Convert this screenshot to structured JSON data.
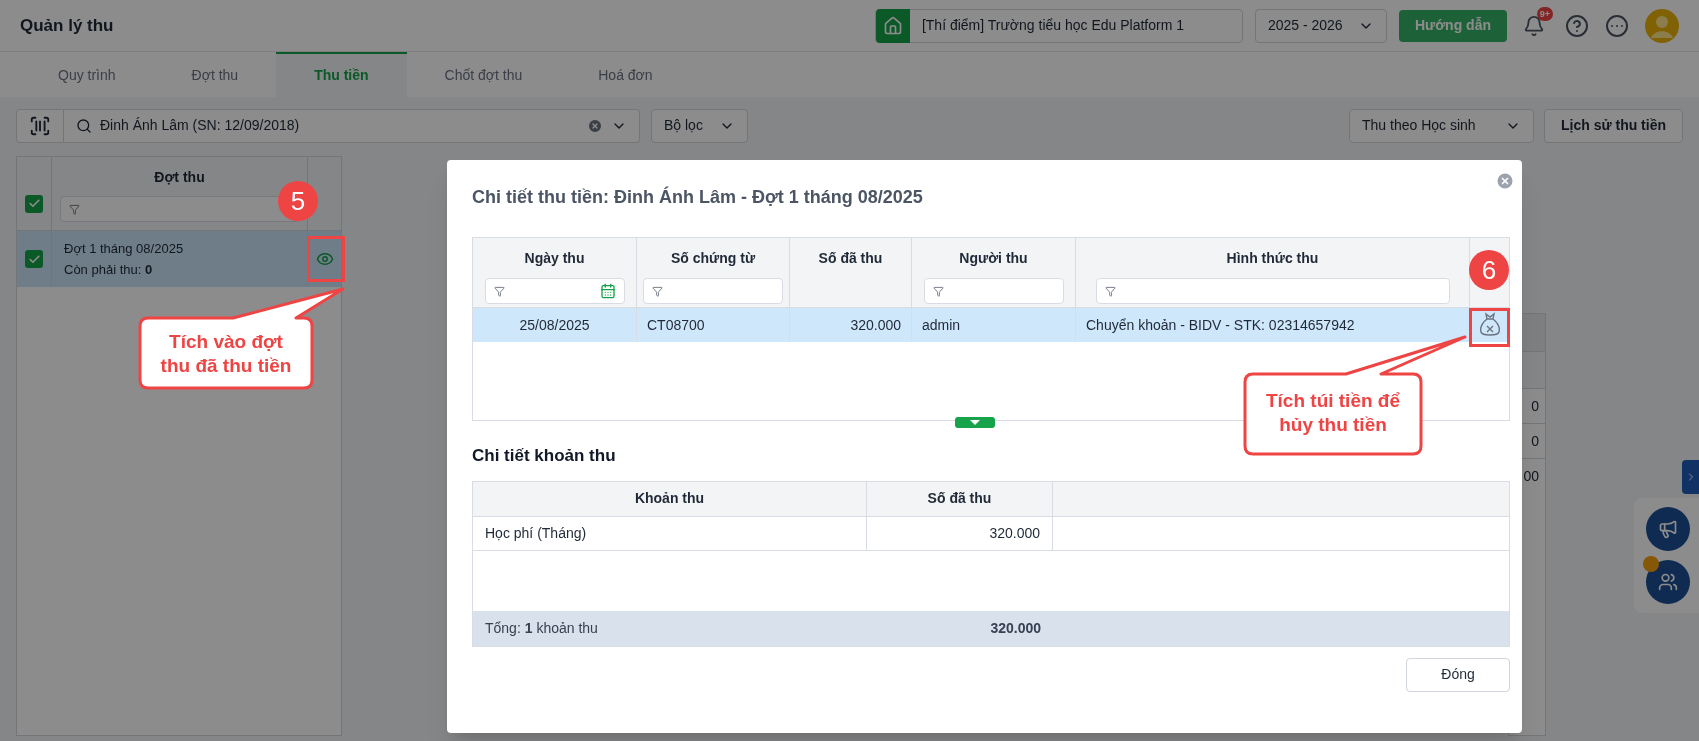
{
  "app_bar": {
    "title": "Quản lý thu",
    "school": "[Thí điểm] Trường tiểu học Edu Platform 1",
    "year": "2025 - 2026",
    "guide_button": "Hướng dẫn",
    "notification_badge": "9+"
  },
  "tabs": [
    {
      "label": "Quy trình",
      "selected": false
    },
    {
      "label": "Đợt thu",
      "selected": false
    },
    {
      "label": "Thu tiền",
      "selected": true
    },
    {
      "label": "Chốt đợt thu",
      "selected": false
    },
    {
      "label": "Hoá đơn",
      "selected": false
    }
  ],
  "toolbar": {
    "search_value": "Đinh Ánh Lâm (SN: 12/09/2018)",
    "filter": "Bộ lọc",
    "mode": "Thu theo Học sinh",
    "history_button": "Lịch sử thu tiền"
  },
  "batch_table": {
    "column": "Đợt thu",
    "all_checked": true,
    "rows": [
      {
        "name": "Đợt 1 tháng 08/2025",
        "remaining_label": "Còn phải thu:",
        "remaining": "0",
        "checked": true,
        "selected": true
      }
    ]
  },
  "background_cells": [
    "0",
    "0",
    "00"
  ],
  "modal": {
    "title": "Chi tiết thu tiền: Đinh Ánh Lâm - Đợt 1 tháng 08/2025",
    "payments": {
      "columns": [
        {
          "label": "Ngày thu",
          "kind": "date"
        },
        {
          "label": "Số chứng từ",
          "kind": "text"
        },
        {
          "label": "Số đã thu",
          "kind": "plain"
        },
        {
          "label": "Người thu",
          "kind": "text"
        },
        {
          "label": "Hình thức thu",
          "kind": "text"
        }
      ],
      "rows": [
        {
          "date": "25/08/2025",
          "voucher": "CT08700",
          "amount": "320.000",
          "collector": "admin",
          "method": "Chuyển khoản - BIDV - STK: 02314657942",
          "selected": true
        }
      ]
    },
    "items_title": "Chi tiết khoản thu",
    "items": {
      "columns": [
        "Khoản thu",
        "Số đã thu"
      ],
      "rows": [
        {
          "name": "Học phí (Tháng)",
          "amount": "320.000"
        }
      ],
      "total": "Tổng: **1** khoản thu",
      "total_amount": "320.000"
    },
    "close_button": "Đóng"
  },
  "annotations": [
    {
      "number": "5",
      "text": "Tích vào đợt thu đã thu tiền"
    },
    {
      "number": "6",
      "text": "Tích túi tiền để hủy thu tiền"
    }
  ]
}
